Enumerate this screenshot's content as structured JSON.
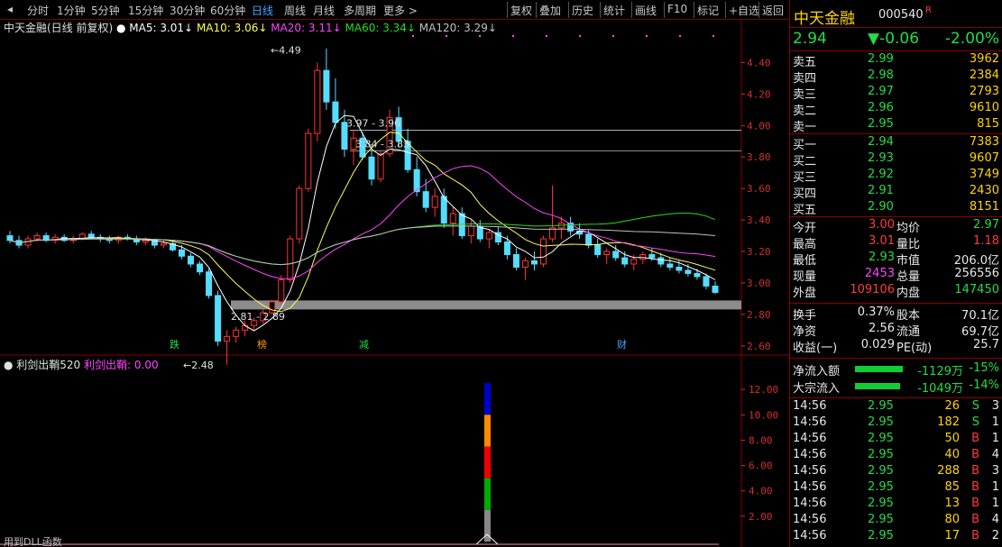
{
  "toolbar": {
    "periods": [
      "分时",
      "1分钟",
      "5分钟",
      "15分钟",
      "30分钟",
      "60分钟",
      "日线",
      "周线",
      "月线",
      "多周期",
      "更多 >"
    ],
    "active": "日线",
    "actions": [
      "复权",
      "叠加",
      "历史",
      "统计",
      "画线",
      "F10",
      "标记",
      "+自选",
      "返回"
    ]
  },
  "chart_header": {
    "name": "中天金融(日线 前复权)",
    "ma5": "MA5: 3.01↓",
    "ma10": "MA10: 3.06↓",
    "ma20": "MA20: 3.11↓",
    "ma60": "MA60: 3.34↓",
    "ma120": "MA120: 3.29↓"
  },
  "colors": {
    "up": "#ff3333",
    "down": "#55ddff",
    "ma5": "#ffffff",
    "ma10": "#ffff55",
    "ma20": "#ff44ff",
    "ma60": "#22dd22",
    "ma120": "#c0c0c0"
  },
  "price_axis": [
    "4.40",
    "4.20",
    "4.00",
    "3.80",
    "3.60",
    "3.40",
    "3.20",
    "3.00",
    "2.80",
    "2.60"
  ],
  "annotations": {
    "high": "4.49",
    "low": "2.48",
    "range1": "3.97 - 3.96",
    "range2": "3.84 - 3.83",
    "range3": "2.81 - 2.89",
    "marks": [
      "跌",
      "榜",
      "减",
      "财"
    ]
  },
  "indicator": {
    "title": "利剑出鞘520",
    "value": "利剑出鞘: 0.00",
    "axis": [
      "12.00",
      "10.00",
      "8.00",
      "6.00",
      "4.00",
      "2.00"
    ],
    "footer": "用到DLL函数"
  },
  "quote": {
    "name": "中天金融",
    "code": "000540",
    "flag": "R",
    "price": "2.94",
    "change": "▼-0.06",
    "pct": "-2.00%"
  },
  "sell": [
    {
      "label": "卖五",
      "price": "2.99",
      "vol": "3962"
    },
    {
      "label": "卖四",
      "price": "2.98",
      "vol": "2384"
    },
    {
      "label": "卖三",
      "price": "2.97",
      "vol": "2793"
    },
    {
      "label": "卖二",
      "price": "2.96",
      "vol": "9610"
    },
    {
      "label": "卖一",
      "price": "2.95",
      "vol": "815"
    }
  ],
  "buy": [
    {
      "label": "买一",
      "price": "2.94",
      "vol": "7383"
    },
    {
      "label": "买二",
      "price": "2.93",
      "vol": "9607"
    },
    {
      "label": "买三",
      "price": "2.92",
      "vol": "3749"
    },
    {
      "label": "买四",
      "price": "2.91",
      "vol": "2430"
    },
    {
      "label": "买五",
      "price": "2.90",
      "vol": "8151"
    }
  ],
  "stats": [
    {
      "l1": "今开",
      "v1": "3.00",
      "l2": "均价",
      "v2": "2.97"
    },
    {
      "l1": "最高",
      "v1": "3.01",
      "l2": "量比",
      "v2": "1.18"
    },
    {
      "l1": "最低",
      "v1": "2.93",
      "l2": "市值",
      "v2": "206.0亿"
    },
    {
      "l1": "现量",
      "v1": "2453",
      "l2": "总量",
      "v2": "256556"
    },
    {
      "l1": "外盘",
      "v1": "109106",
      "l2": "内盘",
      "v2": "147450"
    }
  ],
  "stats2": [
    {
      "l1": "换手",
      "v1": "0.37%",
      "l2": "股本",
      "v2": "70.1亿"
    },
    {
      "l1": "净资",
      "v1": "2.56",
      "l2": "流通",
      "v2": "69.7亿"
    },
    {
      "l1": "收益(一)",
      "v1": "0.029",
      "l2": "PE(动)",
      "v2": "25.7"
    }
  ],
  "flows": [
    {
      "label": "净流入额",
      "amount": "-1129万",
      "pct": "-15%",
      "bar": 0.95
    },
    {
      "label": "大宗流入",
      "amount": "-1049万",
      "pct": "-14%",
      "bar": 0.9
    }
  ],
  "ticks": [
    {
      "time": "14:56",
      "price": "2.95",
      "vol": "26",
      "side": "S",
      "num": "3"
    },
    {
      "time": "14:56",
      "price": "2.95",
      "vol": "182",
      "side": "S",
      "num": "1"
    },
    {
      "time": "14:56",
      "price": "2.95",
      "vol": "50",
      "side": "B",
      "num": "1"
    },
    {
      "time": "14:56",
      "price": "2.95",
      "vol": "40",
      "side": "B",
      "num": "4"
    },
    {
      "time": "14:56",
      "price": "2.95",
      "vol": "288",
      "side": "B",
      "num": "3"
    },
    {
      "time": "14:56",
      "price": "2.95",
      "vol": "85",
      "side": "B",
      "num": "1"
    },
    {
      "time": "14:56",
      "price": "2.95",
      "vol": "13",
      "side": "B",
      "num": "1"
    },
    {
      "time": "14:56",
      "price": "2.95",
      "vol": "80",
      "side": "B",
      "num": "4"
    },
    {
      "time": "14:56",
      "price": "2.95",
      "vol": "17",
      "side": "B",
      "num": "2"
    }
  ],
  "chart_data": {
    "type": "candlestick",
    "ylim": [
      2.45,
      4.5
    ],
    "candles": [
      [
        3.3,
        3.33,
        3.25,
        3.27
      ],
      [
        3.27,
        3.3,
        3.22,
        3.24
      ],
      [
        3.24,
        3.3,
        3.22,
        3.28
      ],
      [
        3.28,
        3.32,
        3.26,
        3.3
      ],
      [
        3.3,
        3.32,
        3.26,
        3.27
      ],
      [
        3.27,
        3.31,
        3.25,
        3.29
      ],
      [
        3.29,
        3.31,
        3.26,
        3.27
      ],
      [
        3.27,
        3.3,
        3.25,
        3.28
      ],
      [
        3.28,
        3.32,
        3.27,
        3.31
      ],
      [
        3.31,
        3.33,
        3.28,
        3.29
      ],
      [
        3.29,
        3.31,
        3.26,
        3.28
      ],
      [
        3.28,
        3.3,
        3.25,
        3.27
      ],
      [
        3.27,
        3.3,
        3.25,
        3.29
      ],
      [
        3.29,
        3.31,
        3.27,
        3.28
      ],
      [
        3.28,
        3.3,
        3.24,
        3.26
      ],
      [
        3.26,
        3.29,
        3.24,
        3.27
      ],
      [
        3.27,
        3.28,
        3.22,
        3.24
      ],
      [
        3.24,
        3.27,
        3.22,
        3.25
      ],
      [
        3.25,
        3.27,
        3.2,
        3.21
      ],
      [
        3.21,
        3.24,
        3.15,
        3.17
      ],
      [
        3.17,
        3.19,
        3.1,
        3.12
      ],
      [
        3.12,
        3.14,
        3.05,
        3.07
      ],
      [
        3.07,
        3.09,
        2.9,
        2.92
      ],
      [
        2.92,
        2.95,
        2.6,
        2.63
      ],
      [
        2.63,
        2.7,
        2.48,
        2.66
      ],
      [
        2.66,
        2.72,
        2.62,
        2.7
      ],
      [
        2.7,
        2.76,
        2.66,
        2.73
      ],
      [
        2.73,
        2.78,
        2.7,
        2.76
      ],
      [
        2.76,
        2.83,
        2.74,
        2.81
      ],
      [
        2.81,
        2.89,
        2.8,
        2.88
      ],
      [
        2.88,
        3.05,
        2.86,
        3.02
      ],
      [
        3.02,
        3.3,
        3.0,
        3.28
      ],
      [
        3.28,
        3.62,
        3.25,
        3.6
      ],
      [
        3.6,
        3.98,
        3.58,
        3.95
      ],
      [
        3.95,
        4.4,
        3.9,
        4.35
      ],
      [
        4.35,
        4.49,
        4.1,
        4.15
      ],
      [
        4.15,
        4.3,
        3.98,
        4.02
      ],
      [
        4.02,
        4.1,
        3.8,
        3.85
      ],
      [
        3.85,
        3.97,
        3.75,
        3.92
      ],
      [
        3.92,
        3.96,
        3.78,
        3.8
      ],
      [
        3.8,
        3.88,
        3.62,
        3.66
      ],
      [
        3.66,
        3.84,
        3.64,
        3.82
      ],
      [
        3.82,
        4.1,
        3.8,
        4.05
      ],
      [
        4.05,
        4.12,
        3.86,
        3.9
      ],
      [
        3.9,
        3.98,
        3.7,
        3.72
      ],
      [
        3.72,
        3.8,
        3.55,
        3.58
      ],
      [
        3.58,
        3.66,
        3.45,
        3.48
      ],
      [
        3.48,
        3.6,
        3.42,
        3.55
      ],
      [
        3.55,
        3.6,
        3.35,
        3.38
      ],
      [
        3.38,
        3.48,
        3.3,
        3.44
      ],
      [
        3.44,
        3.48,
        3.28,
        3.3
      ],
      [
        3.3,
        3.4,
        3.25,
        3.36
      ],
      [
        3.36,
        3.4,
        3.26,
        3.28
      ],
      [
        3.28,
        3.34,
        3.22,
        3.32
      ],
      [
        3.32,
        3.36,
        3.24,
        3.26
      ],
      [
        3.26,
        3.3,
        3.15,
        3.18
      ],
      [
        3.18,
        3.22,
        3.08,
        3.1
      ],
      [
        3.1,
        3.16,
        3.02,
        3.14
      ],
      [
        3.14,
        3.2,
        3.08,
        3.12
      ],
      [
        3.12,
        3.3,
        3.1,
        3.28
      ],
      [
        3.28,
        3.62,
        3.26,
        3.35
      ],
      [
        3.35,
        3.42,
        3.28,
        3.38
      ],
      [
        3.38,
        3.42,
        3.3,
        3.33
      ],
      [
        3.33,
        3.38,
        3.28,
        3.31
      ],
      [
        3.31,
        3.34,
        3.22,
        3.24
      ],
      [
        3.24,
        3.28,
        3.16,
        3.18
      ],
      [
        3.18,
        3.22,
        3.12,
        3.2
      ],
      [
        3.2,
        3.24,
        3.14,
        3.16
      ],
      [
        3.16,
        3.2,
        3.1,
        3.12
      ],
      [
        3.12,
        3.18,
        3.08,
        3.15
      ],
      [
        3.15,
        3.2,
        3.12,
        3.18
      ],
      [
        3.18,
        3.22,
        3.14,
        3.16
      ],
      [
        3.16,
        3.19,
        3.1,
        3.12
      ],
      [
        3.12,
        3.16,
        3.08,
        3.1
      ],
      [
        3.1,
        3.14,
        3.06,
        3.08
      ],
      [
        3.08,
        3.12,
        3.04,
        3.06
      ],
      [
        3.06,
        3.09,
        3.02,
        3.04
      ],
      [
        3.04,
        3.06,
        2.96,
        2.98
      ],
      [
        2.98,
        3.01,
        2.93,
        2.94
      ]
    ],
    "volume_bar": {
      "segments": [
        "#0000cc",
        "#ff8800",
        "#ee0000",
        "#00aa00",
        "#888888"
      ],
      "value": 12.5
    }
  }
}
